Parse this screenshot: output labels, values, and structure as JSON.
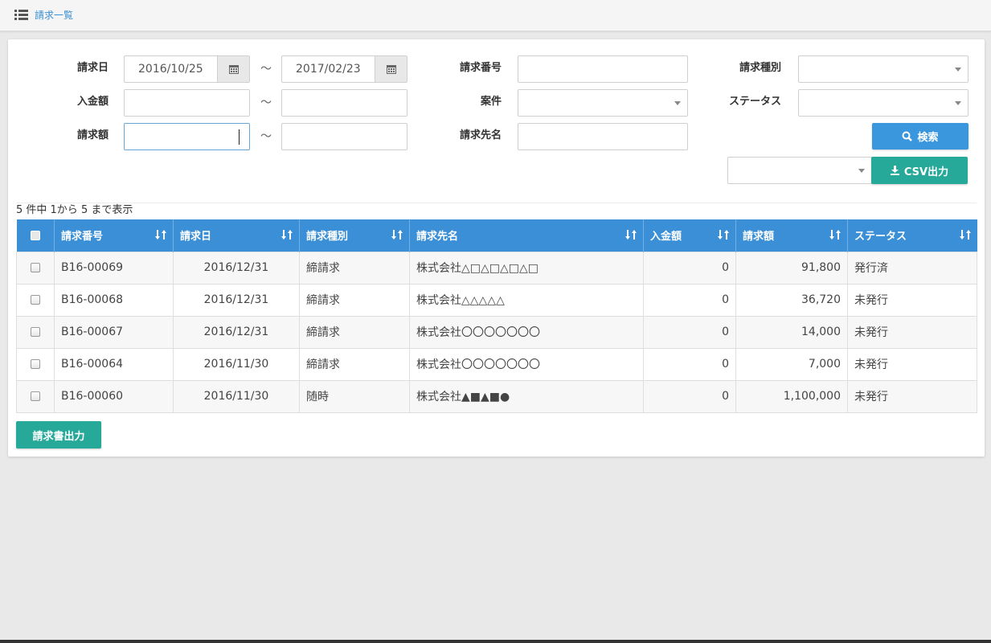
{
  "header": {
    "breadcrumb": "請求一覧"
  },
  "filters": {
    "billing_date_label": "請求日",
    "billing_date_from": "2016/10/25",
    "billing_date_to": "2017/02/23",
    "tilde": "～",
    "payment_label": "入金額",
    "amount_label": "請求額",
    "invoice_no_label": "請求番号",
    "project_label": "案件",
    "client_label": "請求先名",
    "invoice_type_label": "請求種別",
    "status_label": "ステータス"
  },
  "buttons": {
    "search": "検索",
    "csv": "CSV出力",
    "invoice_output": "請求書出力"
  },
  "table": {
    "count_text": "5 件中 1から 5 まで表示",
    "headers": [
      "請求番号",
      "請求日",
      "請求種別",
      "請求先名",
      "入金額",
      "請求額",
      "ステータス"
    ],
    "rows": [
      [
        "B16-00069",
        "2016/12/31",
        "締請求",
        "株式会社△□△□△□△□",
        "0",
        "91,800",
        "発行済"
      ],
      [
        "B16-00068",
        "2016/12/31",
        "締請求",
        "株式会社△△△△△",
        "0",
        "36,720",
        "未発行"
      ],
      [
        "B16-00067",
        "2016/12/31",
        "締請求",
        "株式会社〇〇〇〇〇〇〇",
        "0",
        "14,000",
        "未発行"
      ],
      [
        "B16-00064",
        "2016/11/30",
        "締請求",
        "株式会社〇〇〇〇〇〇〇",
        "0",
        "7,000",
        "未発行"
      ],
      [
        "B16-00060",
        "2016/11/30",
        "随時",
        "株式会社▲■▲■●",
        "0",
        "1,100,000",
        "未発行"
      ]
    ]
  },
  "colors": {
    "primary": "#3a97dd",
    "table_header": "#3a8fd6",
    "teal": "#27a99a"
  },
  "icons": {
    "breadcrumb": "list-icon",
    "date": "calendar-icon",
    "search": "search-icon",
    "csv": "download-icon",
    "sort": "sort-icon",
    "select": "chevron-down-icon"
  }
}
